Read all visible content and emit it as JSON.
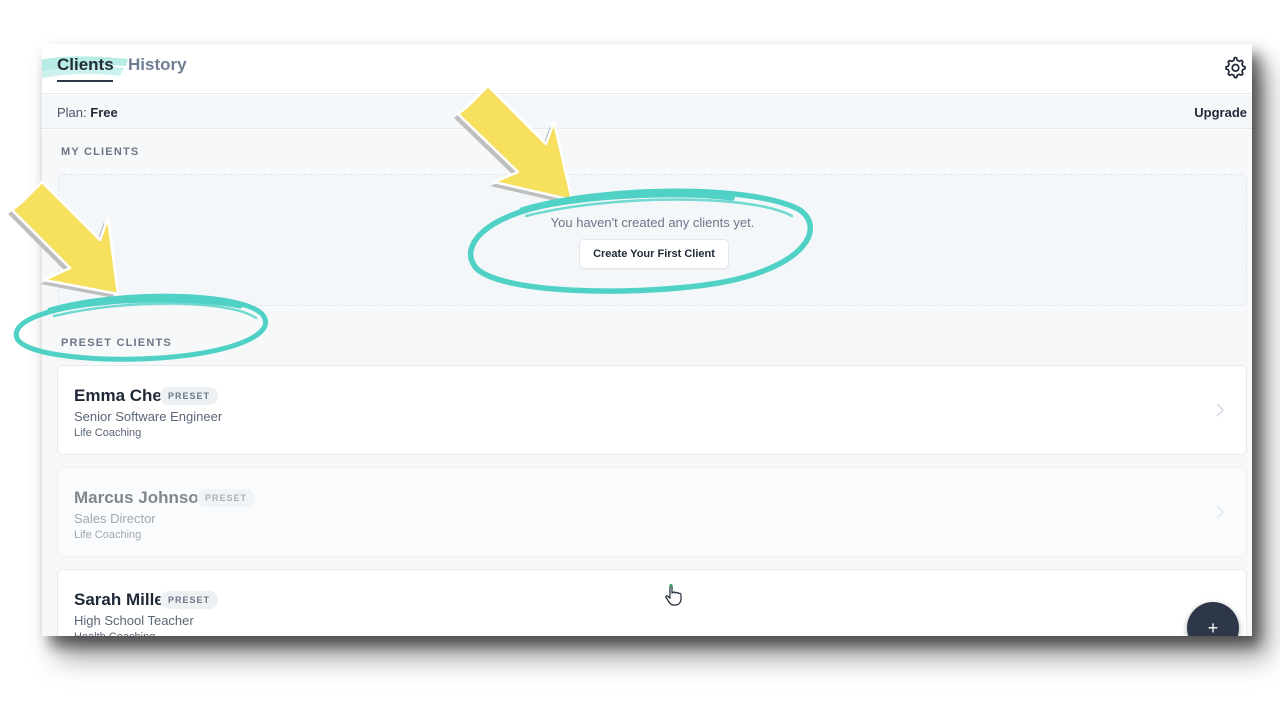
{
  "tabs": {
    "clients_label": "Clients",
    "history_label": "History"
  },
  "plan": {
    "label": "Plan:",
    "value": "Free",
    "upgrade_label": "Upgrade"
  },
  "my_clients": {
    "title": "MY CLIENTS",
    "empty_text": "You haven't created any clients yet.",
    "create_button": "Create Your First Client"
  },
  "preset_clients": {
    "title": "PRESET CLIENTS",
    "badge": "PRESET",
    "items": [
      {
        "name": "Emma Chen",
        "role": "Senior Software Engineer",
        "type": "Life Coaching"
      },
      {
        "name": "Marcus Johnson",
        "role": "Sales Director",
        "type": "Life Coaching"
      },
      {
        "name": "Sarah Miller",
        "role": "High School Teacher",
        "type": "Health Coaching"
      }
    ]
  },
  "fab": {
    "label": "+"
  },
  "icons": {
    "settings": "gear-icon",
    "chevron": "chevron-right-icon",
    "add": "plus-icon",
    "cursor": "hand-pointer-icon"
  },
  "colors": {
    "accent_teal": "#4fd1c5",
    "arrow_yellow": "#f6e05e",
    "fab_bg": "#2d3748",
    "text_dark": "#1f2937"
  }
}
